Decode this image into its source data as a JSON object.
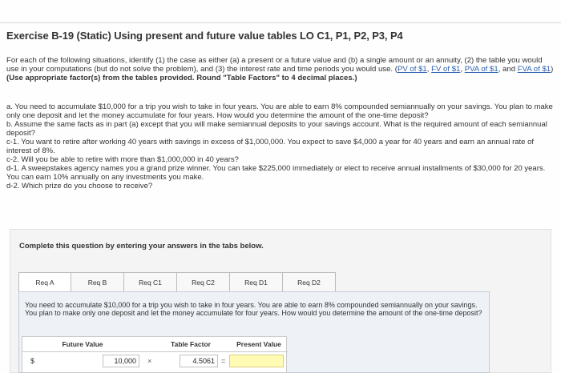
{
  "header": {
    "title": "Exercise B-19 (Static) Using present and future value tables LO C1, P1, P2, P3, P4"
  },
  "intro": {
    "part1": "For each of the following situations, identify (1) the case as either (a) a present or a future value and (b) a single amount or an annuity, (2) the table you would use in your computations (but do not solve the problem), and (3) the interest rate and time periods you would use. (",
    "links": [
      "PV of $1",
      "FV of $1",
      "PVA of $1",
      "FVA of $1"
    ],
    "sep": ", ",
    "and": ", and ",
    "close": ")",
    "bold": " (Use appropriate factor(s) from the tables provided. Round \"Table Factors\" to 4 decimal places.)"
  },
  "requirements": [
    "a. You need to accumulate $10,000 for a trip you wish to take in four years. You are able to earn 8% compounded semiannually on your savings. You plan to make only one deposit and let the money accumulate for four years. How would you determine the amount of the one-time deposit?",
    "b. Assume the same facts as in part (a) except that you will make semiannual deposits to your savings account. What is the required amount of each semiannual deposit?",
    "c-1. You want to retire after working 40 years with savings in excess of $1,000,000. You expect to save $4,000 a year for 40 years and earn an annual rate of interest of 8%.",
    "c-2. Will you be able to retire with more than $1,000,000 in 40 years?",
    "d-1. A sweepstakes agency names you a grand prize winner. You can take $225,000 immediately or elect to receive annual installments of $30,000 for 20 years. You can earn 10% annually on any investments you make.",
    "d-2. Which prize do you choose to receive?"
  ],
  "complete_prompt": "Complete this question by entering your answers in the tabs below.",
  "tabs": [
    "Req A",
    "Req B",
    "Req C1",
    "Req C2",
    "Req D1",
    "Req D2"
  ],
  "active_tab": "Req A",
  "panel": {
    "question": "You need to accumulate $10,000 for a trip you wish to take in four years. You are able to earn 8% compounded semiannually on your savings. You plan to make only one deposit and let the money accumulate for four years. How would you determine the amount of the one-time deposit?",
    "table": {
      "headers": [
        "Future Value",
        "Table Factor",
        "Present Value"
      ],
      "currency": "$",
      "future_value": "10,000",
      "times": "×",
      "table_factor": "4.5061",
      "equals": "=",
      "present_value": ""
    }
  }
}
